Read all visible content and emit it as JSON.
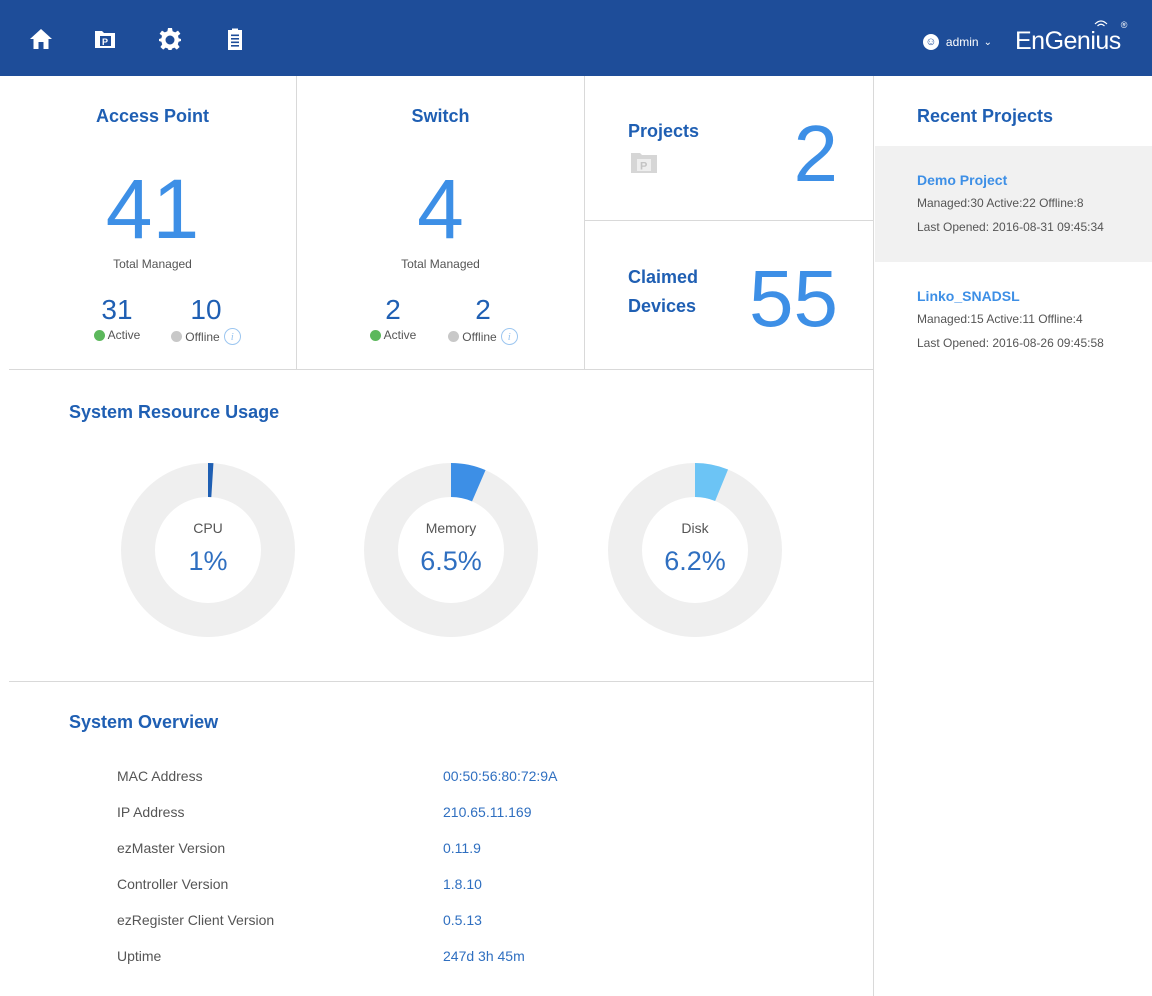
{
  "header": {
    "nav_icons": [
      "home-icon",
      "project-icon",
      "settings-icon",
      "clipboard-icon"
    ],
    "user_name": "admin",
    "brand": "EnGenius",
    "brand_mark": "®",
    "bar_color": "#1e4d99"
  },
  "access_point": {
    "title": "Access Point",
    "total": "41",
    "total_label": "Total Managed",
    "active": "31",
    "active_label": "Active",
    "offline": "10",
    "offline_label": "Offline"
  },
  "switch": {
    "title": "Switch",
    "total": "4",
    "total_label": "Total Managed",
    "active": "2",
    "active_label": "Active",
    "offline": "2",
    "offline_label": "Offline"
  },
  "projects": {
    "label": "Projects",
    "count": "2"
  },
  "claimed": {
    "label_line1": "Claimed",
    "label_line2": "Devices",
    "count": "55"
  },
  "resource": {
    "title": "System Resource Usage",
    "gauges": [
      {
        "name": "CPU",
        "display": "1%",
        "fraction": 0.01,
        "color": "#1f5fb3"
      },
      {
        "name": "Memory",
        "display": "6.5%",
        "fraction": 0.065,
        "color": "#3d8fe6"
      },
      {
        "name": "Disk",
        "display": "6.2%",
        "fraction": 0.062,
        "color": "#6cc4f5"
      }
    ]
  },
  "overview": {
    "title": "System Overview",
    "rows": [
      {
        "key": "MAC Address",
        "value": "00:50:56:80:72:9A"
      },
      {
        "key": "IP Address",
        "value": "210.65.11.169"
      },
      {
        "key": "ezMaster Version",
        "value": "0.11.9"
      },
      {
        "key": "Controller Version",
        "value": "1.8.10"
      },
      {
        "key": "ezRegister Client Version",
        "value": "0.5.13"
      },
      {
        "key": "Uptime",
        "value": "247d 3h 45m"
      }
    ]
  },
  "recent": {
    "title": "Recent Projects",
    "items": [
      {
        "name": "Demo Project",
        "stats": "Managed:30   Active:22   Offline:8",
        "opened": "Last Opened: 2016-08-31 09:45:34"
      },
      {
        "name": "Linko_SNADSL",
        "stats": "Managed:15   Active:11   Offline:4",
        "opened": "Last Opened: 2016-08-26 09:45:58"
      }
    ]
  }
}
